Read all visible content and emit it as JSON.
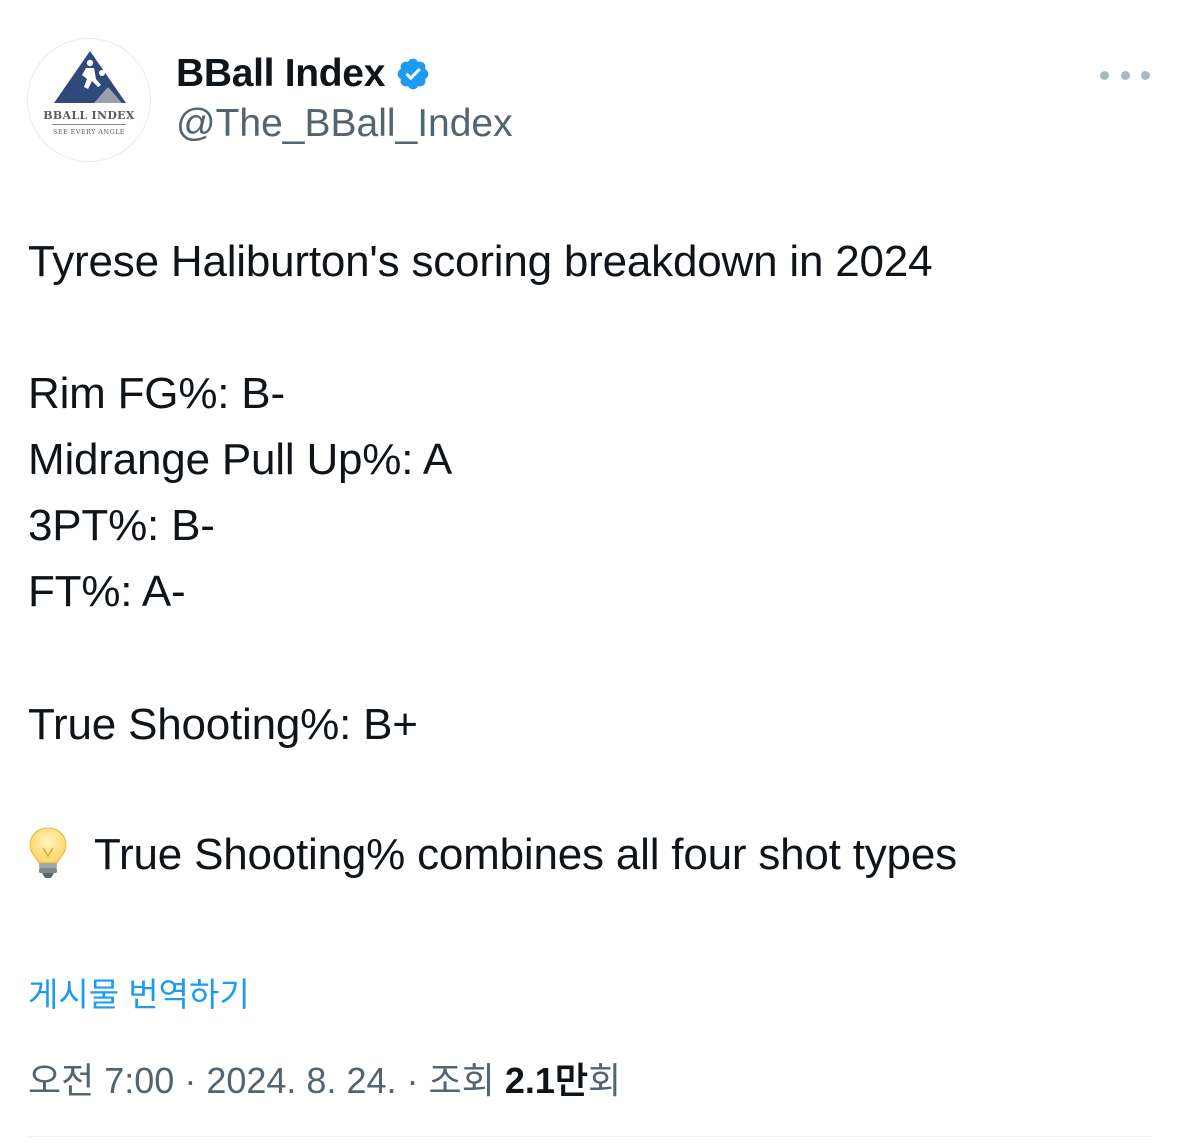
{
  "author": {
    "avatar": {
      "icon": "bball-index-logo-icon",
      "logo_name": "BBALL INDEX",
      "logo_tagline": "SEE EVERY ANGLE"
    },
    "display_name": "BBall Index",
    "verified_icon": "verified-badge-icon",
    "verified_color": "#1d9bf0",
    "handle": "@The_BBall_Index"
  },
  "more_icon": "more-options-icon",
  "tweet": {
    "lines": [
      "Tyrese Haliburton's scoring breakdown in 2024",
      "Rim FG%: B-",
      "Midrange Pull Up%: A",
      "3PT%: B-",
      "FT%: A-",
      "True Shooting%: B+",
      "True Shooting% combines all four shot types"
    ],
    "tip_icon": "light-bulb-icon"
  },
  "translate_label": "게시물 번역하기",
  "meta": {
    "time": "오전 7:00",
    "separator": "·",
    "date": "2024. 8. 24.",
    "views_label": "조회",
    "views_count": "2.1만",
    "views_suffix": "회"
  },
  "colors": {
    "text": "#0f1419",
    "secondary": "#536471",
    "accent": "#1d9bf0"
  }
}
